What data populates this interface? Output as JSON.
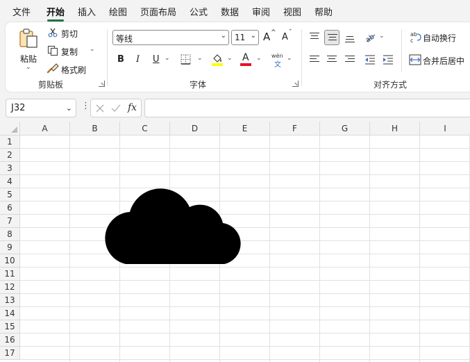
{
  "menu": {
    "tabs": [
      "文件",
      "开始",
      "插入",
      "绘图",
      "页面布局",
      "公式",
      "数据",
      "审阅",
      "视图",
      "帮助"
    ],
    "active": "开始"
  },
  "clipboard": {
    "paste": "粘贴",
    "cut": "剪切",
    "copy": "复制",
    "format_painter": "格式刷",
    "group_label": "剪贴板"
  },
  "font": {
    "name": "等线",
    "size": "11",
    "bold": "B",
    "italic": "I",
    "underline": "U",
    "font_color_glyph": "A",
    "phonetic_top": "wén",
    "phonetic_bottom": "文",
    "increase_glyph": "A",
    "decrease_glyph": "A",
    "group_label": "字体",
    "highlight_color": "#ffff00",
    "font_color": "#e81123"
  },
  "alignment": {
    "wrap_text": "自动换行",
    "merge_center": "合并后居中",
    "group_label": "对齐方式"
  },
  "formula_bar": {
    "name_box": "J32",
    "fx": "fx",
    "formula": ""
  },
  "grid": {
    "columns": [
      "A",
      "B",
      "C",
      "D",
      "E",
      "F",
      "G",
      "H",
      "I"
    ],
    "rows": [
      "1",
      "2",
      "3",
      "4",
      "5",
      "6",
      "7",
      "8",
      "9",
      "10",
      "11",
      "12",
      "13",
      "14",
      "15",
      "16",
      "17"
    ]
  },
  "shape": {
    "name": "cloud-icon",
    "fill": "#000000"
  },
  "colors": {
    "accent": "#217346",
    "ribbon_bg": "#ffffff",
    "app_bg": "#f3f3f3"
  }
}
